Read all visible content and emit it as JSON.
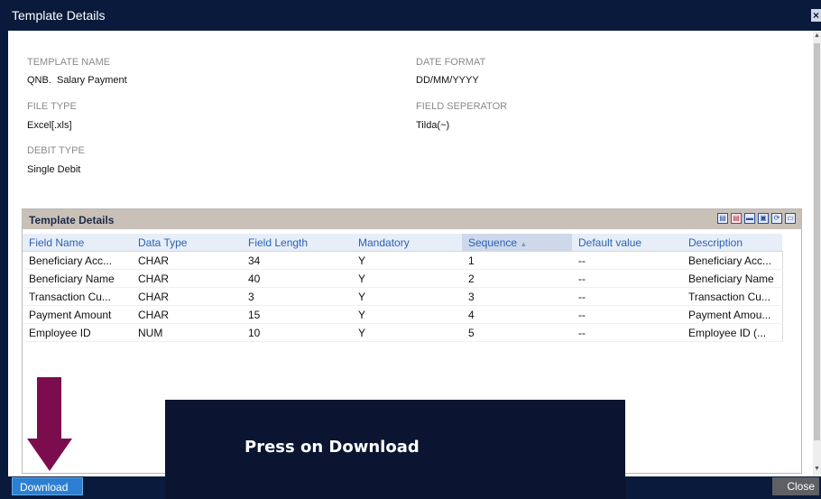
{
  "dialog": {
    "title": "Template Details"
  },
  "fields": {
    "template_name_label": "TEMPLATE NAME",
    "template_name_value": "QNB.  Salary Payment",
    "date_format_label": "DATE FORMAT",
    "date_format_value": "DD/MM/YYYY",
    "file_type_label": "FILE TYPE",
    "file_type_value": "Excel[.xls]",
    "field_separator_label": "FIELD SEPERATOR",
    "field_separator_value": "Tilda(~)",
    "debit_type_label": "DEBIT TYPE",
    "debit_type_value": "Single Debit"
  },
  "grid": {
    "title": "Template Details",
    "toolbar_icons": [
      "export-excel-icon",
      "export-pdf-icon",
      "print-icon",
      "print-preview-icon",
      "refresh-icon",
      "save-icon"
    ],
    "columns": [
      "Field Name",
      "Data Type",
      "Field Length",
      "Mandatory",
      "Sequence",
      "Default value",
      "Description"
    ],
    "sorted_column": "Sequence",
    "sort_direction": "ascending",
    "rows": [
      [
        "Beneficiary Acc...",
        "CHAR",
        "34",
        "Y",
        "1",
        "--",
        "Beneficiary Acc..."
      ],
      [
        "Beneficiary Name",
        "CHAR",
        "40",
        "Y",
        "2",
        "--",
        "Beneficiary Name"
      ],
      [
        "Transaction Cu...",
        "CHAR",
        "3",
        "Y",
        "3",
        "--",
        "Transaction Cu..."
      ],
      [
        "Payment Amount",
        "CHAR",
        "15",
        "Y",
        "4",
        "--",
        "Payment Amou..."
      ],
      [
        "Employee ID",
        "NUM",
        "10",
        "Y",
        "5",
        "--",
        "Employee ID (..."
      ]
    ]
  },
  "footer": {
    "download_label": "Download",
    "close_label": "Close"
  },
  "annotation": {
    "callout_text": "Press on Download",
    "arrow_color": "#7b0d4e"
  },
  "colors": {
    "titlebar": "#0a1a3c",
    "header_link": "#2a62b8",
    "download_button": "#2c7fd1"
  }
}
